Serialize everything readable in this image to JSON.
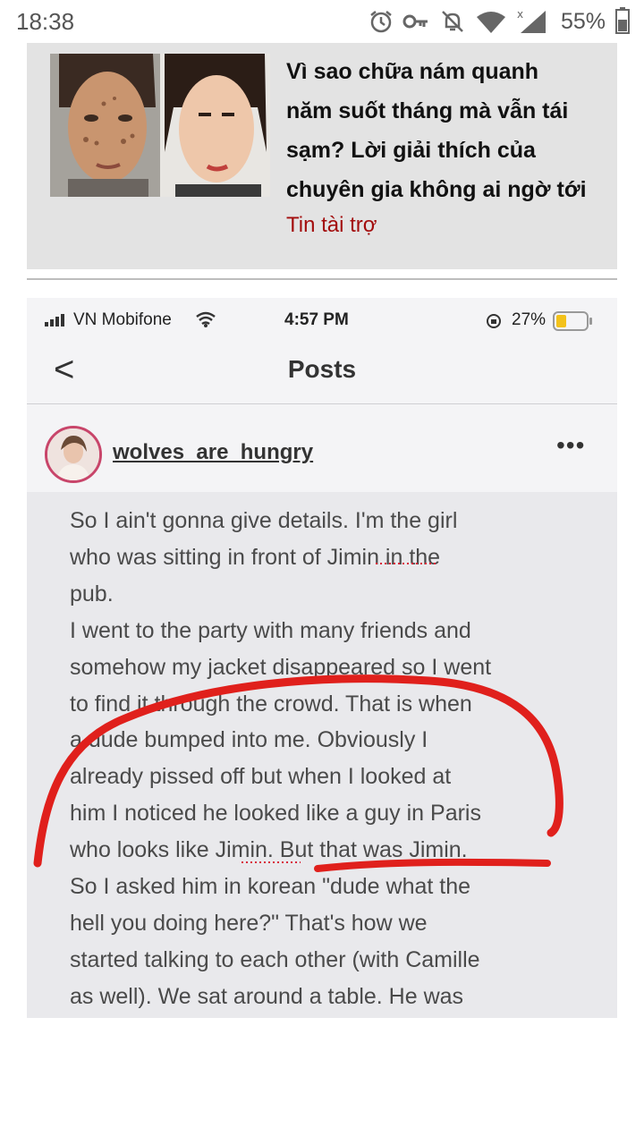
{
  "status_bar": {
    "time": "18:38",
    "battery_pct": "55%",
    "icons": [
      "alarm-icon",
      "vpn-key-icon",
      "notifications-off-icon",
      "wifi-icon",
      "signal-icon",
      "battery-icon"
    ]
  },
  "ad": {
    "title": "Vì sao chữa nám quanh năm suốt tháng mà vẫn tái sạm? Lời giải thích của chuyên gia không ai ngờ tới",
    "title_lines": [
      "Vì sao chữa nám quanh",
      "năm suốt tháng mà vẫn tái",
      "sạm? Lời giải thích của",
      "chuyên gia không ai ngờ tới"
    ],
    "sponsor": "Tin tài trợ"
  },
  "screenshot": {
    "status": {
      "carrier": "VN Mobifone",
      "time": "4:57 PM",
      "battery": "27%"
    },
    "nav": {
      "back": "<",
      "title": "Posts"
    },
    "post": {
      "username": "wolves_are_hungry",
      "more": "•••",
      "lines": [
        "So I ain't gonna give details. I'm the girl",
        "who was sitting in front of Jimin in the",
        "pub.",
        "I went to the party with many friends and",
        "somehow my jacket disappeared so I went",
        "to find it through the crowd. That is when",
        "a dude bumped into me. Obviously I",
        "already pissed off but when I looked at",
        "him I noticed he looked like a guy in Paris",
        "who looks like Jimin. But that was Jimin.",
        "So I asked him in korean \"dude what the",
        "hell you doing here?\" That's how we",
        "started talking to each other (with Camille",
        "as well). We sat around a table. He was"
      ]
    }
  },
  "colors": {
    "ad_background": "#e3e3e3",
    "sponsor": "#a30d0d",
    "red_marker": "#e0201c",
    "avatar_ring": "#c8456a"
  }
}
